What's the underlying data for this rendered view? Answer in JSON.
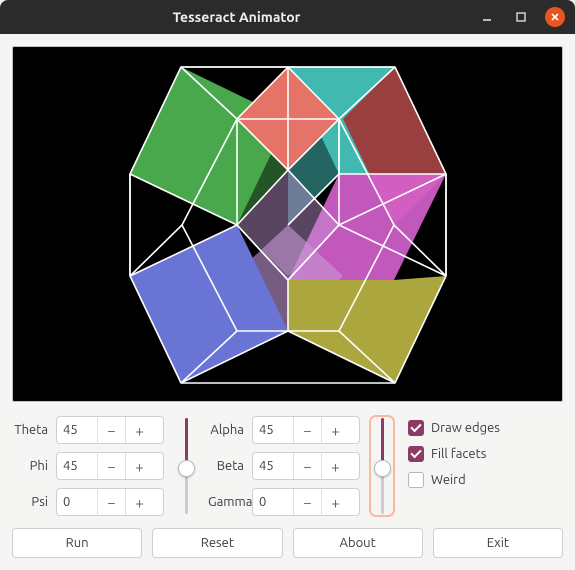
{
  "window": {
    "title": "Tesseract Animator"
  },
  "angles": {
    "theta": {
      "label": "Theta",
      "value": "45"
    },
    "phi": {
      "label": "Phi",
      "value": "45"
    },
    "psi": {
      "label": "Psi",
      "value": "0"
    },
    "alpha": {
      "label": "Alpha",
      "value": "45"
    },
    "beta": {
      "label": "Beta",
      "value": "45"
    },
    "gamma": {
      "label": "Gamma",
      "value": "0"
    }
  },
  "checkboxes": {
    "draw_edges": {
      "label": "Draw edges",
      "checked": true
    },
    "fill_facets": {
      "label": "Fill facets",
      "checked": true
    },
    "weird": {
      "label": "Weird",
      "checked": false
    }
  },
  "buttons": {
    "run": "Run",
    "reset": "Reset",
    "about": "About",
    "exit": "Exit"
  },
  "colors": {
    "accent": "#8a3b66",
    "close": "#e95420",
    "facets": {
      "green": "#49a84c",
      "teal": "#41b8b0",
      "maroon": "#9a3f3f",
      "coral": "#e57368",
      "magenta": "#d862d0",
      "lilac": "#c79ad8",
      "olive": "#aba63d",
      "periwinkle": "#6a74d4"
    }
  }
}
